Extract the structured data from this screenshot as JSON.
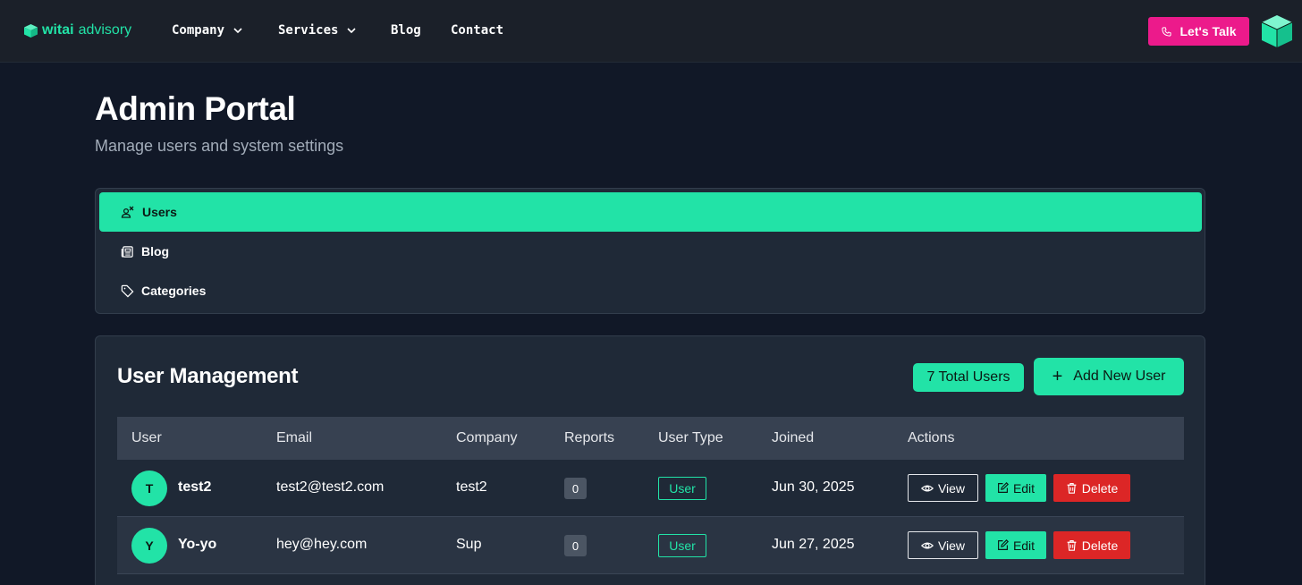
{
  "nav": {
    "logo_bold": "witai",
    "logo_rest": "advisory",
    "links": [
      {
        "label": "Company",
        "dropdown": true
      },
      {
        "label": "Services",
        "dropdown": true
      },
      {
        "label": "Blog",
        "dropdown": false
      },
      {
        "label": "Contact",
        "dropdown": false
      }
    ],
    "cta_label": "Let's Talk"
  },
  "header": {
    "title": "Admin Portal",
    "subtitle": "Manage users and system settings"
  },
  "admin_nav": {
    "items": [
      {
        "label": "Users",
        "icon": "users-icon",
        "active": true
      },
      {
        "label": "Blog",
        "icon": "newspaper-icon",
        "active": false
      },
      {
        "label": "Categories",
        "icon": "tag-icon",
        "active": false
      }
    ]
  },
  "user_management": {
    "title": "User Management",
    "total_badge": "7 Total Users",
    "add_button": "Add New User",
    "add_icon": "+",
    "columns": [
      "User",
      "Email",
      "Company",
      "Reports",
      "User Type",
      "Joined",
      "Actions"
    ],
    "actions": {
      "view": "View",
      "edit": "Edit",
      "delete": "Delete"
    },
    "rows": [
      {
        "initial": "T",
        "name": "test2",
        "email": "test2@test2.com",
        "company": "test2",
        "reports": "0",
        "type": "User",
        "joined": "Jun 30, 2025"
      },
      {
        "initial": "Y",
        "name": "Yo-yo",
        "email": "hey@hey.com",
        "company": "Sup",
        "reports": "0",
        "type": "User",
        "joined": "Jun 27, 2025"
      }
    ]
  },
  "colors": {
    "accent": "#22e3a7",
    "cta": "#ec1a8b",
    "danger": "#dc2626",
    "background": "#111827",
    "panel": "#1f2937"
  }
}
